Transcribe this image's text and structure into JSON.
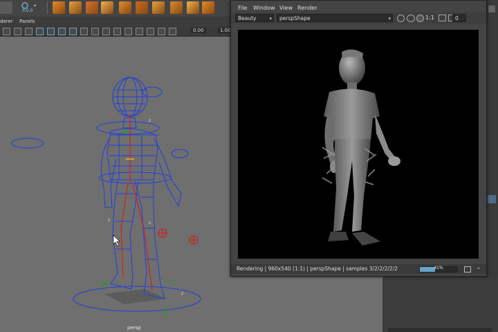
{
  "shelf": {
    "status_text": "0,0,0",
    "icons": [
      "cube-icon",
      "sphere-icon",
      "cylinder-icon",
      "plane-icon",
      "torus-icon",
      "cone-icon",
      "pipe-icon",
      "helix-icon",
      "soccer-icon",
      "prism-icon"
    ]
  },
  "panel_menu": {
    "items": [
      "derer",
      "Panels"
    ]
  },
  "view_tools": {
    "exposure_value": "0.00",
    "gamma_value": "1.00"
  },
  "viewport": {
    "camera_label": "persp",
    "axis_labels": [
      "x",
      "z",
      "x",
      "z",
      "z",
      "x",
      "x",
      "z",
      "y",
      "y"
    ]
  },
  "render_view": {
    "menu": [
      "File",
      "Window",
      "View",
      "Render"
    ],
    "pass_dropdown": "Beauty",
    "camera_dropdown": "perspShape",
    "ratio_label": "1:1",
    "frame_value": "0",
    "status_text": "Rendering | 960x540 (1:1) | perspShape | samples 3/2/2/2/2/2",
    "progress_percent": 41,
    "progress_label": "41%"
  },
  "colors": {
    "viewport_bg": "#6f6f6f",
    "wireframe": "#1f3fe0",
    "accent_blue": "#6aa3c8",
    "shelf_orange": "#e08a2a"
  }
}
